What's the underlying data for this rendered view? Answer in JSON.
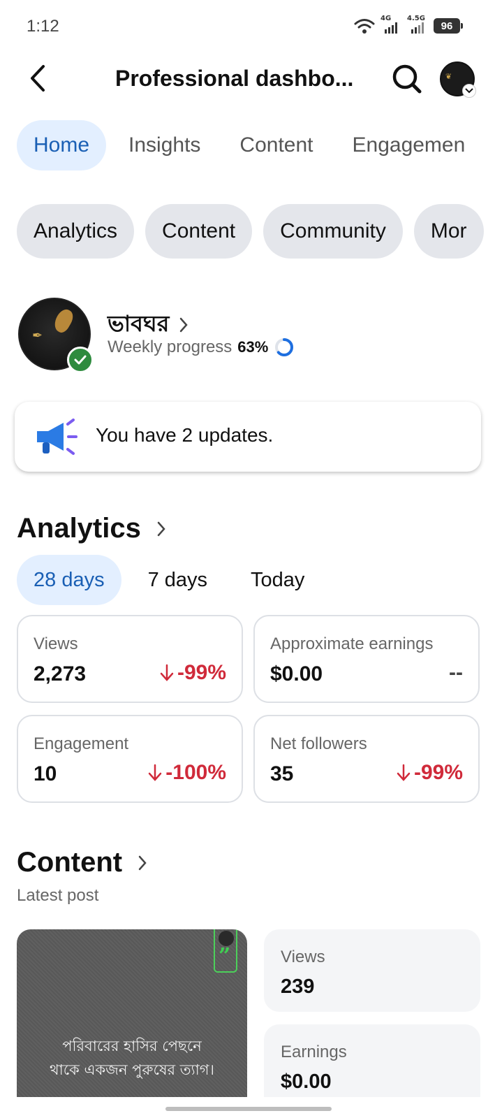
{
  "status_bar": {
    "time": "1:12",
    "signal1_label": "4G",
    "signal2_label": "4.5G",
    "battery": "96"
  },
  "header": {
    "title": "Professional dashbo..."
  },
  "tabs": [
    {
      "label": "Home",
      "active": true
    },
    {
      "label": "Insights",
      "active": false
    },
    {
      "label": "Content",
      "active": false
    },
    {
      "label": "Engagemen",
      "active": false
    }
  ],
  "chips": [
    "Analytics",
    "Content",
    "Community",
    "Mor"
  ],
  "profile": {
    "name": "ভাবঘর",
    "progress_label": "Weekly progress",
    "progress_value": "63%",
    "progress_fraction": 0.63
  },
  "updates": {
    "text": "You have 2 updates."
  },
  "analytics": {
    "title": "Analytics",
    "ranges": [
      {
        "label": "28 days",
        "active": true
      },
      {
        "label": "7 days",
        "active": false
      },
      {
        "label": "Today",
        "active": false
      }
    ],
    "metrics": [
      {
        "label": "Views",
        "value": "2,273",
        "change": "-99%",
        "trend": "down"
      },
      {
        "label": "Approximate earnings",
        "value": "$0.00",
        "change": "--",
        "trend": "none"
      },
      {
        "label": "Engagement",
        "value": "10",
        "change": "-100%",
        "trend": "down"
      },
      {
        "label": "Net followers",
        "value": "35",
        "change": "-99%",
        "trend": "down"
      }
    ]
  },
  "content": {
    "title": "Content",
    "subtitle": "Latest post",
    "post_text": "পরিবারের হাসির পেছনে\nথাকে একজন পুরুষের ত্যাগ।",
    "post_stats": [
      {
        "label": "Views",
        "value": "239"
      },
      {
        "label": "Earnings",
        "value": "$0.00"
      }
    ]
  },
  "colors": {
    "accent": "#1a5fb4",
    "accent_bg": "#e3efff",
    "negative": "#d02a3a",
    "verified": "#2e8b3e",
    "chip_bg": "#e4e6eb"
  }
}
